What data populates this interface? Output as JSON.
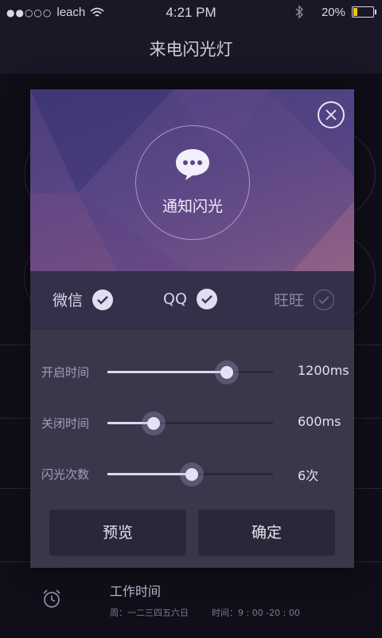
{
  "status_bar": {
    "carrier": "leach",
    "time": "4:21 PM",
    "battery": "20%",
    "battery_level": 0.2
  },
  "nav": {
    "title": "来电闪光灯"
  },
  "background": {
    "work_time": {
      "title": "工作时间",
      "days": "周：一二三四五六日",
      "hours": "时间：9 : 00 -20 : 00"
    }
  },
  "dialog": {
    "notify_label": "通知闪光",
    "apps": [
      {
        "label": "微信",
        "checked": true
      },
      {
        "label": "QQ",
        "checked": true
      },
      {
        "label": "旺旺",
        "checked": false
      }
    ],
    "sliders": [
      {
        "label": "开启时间",
        "value": "1200ms",
        "level": 0.72
      },
      {
        "label": "关闭时间",
        "value": "600ms",
        "level": 0.28
      },
      {
        "label": "闪光次数",
        "value": "6次",
        "level": 0.51
      }
    ],
    "buttons": {
      "preview": "预览",
      "confirm": "确定"
    }
  },
  "icons": {
    "signal": "signal-dots-icon",
    "wifi": "wifi-icon",
    "bluetooth": "bluetooth-icon",
    "battery": "battery-icon",
    "close": "close-icon",
    "notify": "chat-bubble-icon",
    "check": "check-icon",
    "alarm": "alarm-clock-icon"
  },
  "colors": {
    "accent": "#e6e1f4",
    "header_gradient": "#5a4685",
    "battery_fill": "#f2c200"
  }
}
